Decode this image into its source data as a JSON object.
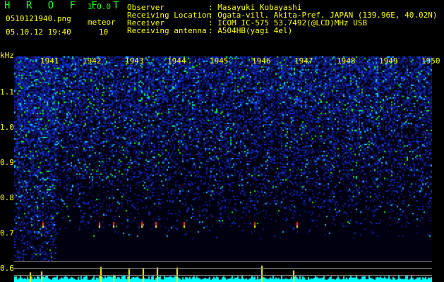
{
  "app": {
    "name": "H R O F F T",
    "version": "1.0.0"
  },
  "file": {
    "name": "0510121940.png",
    "datetime": "05.10.12 19:40"
  },
  "meteor": {
    "label": "meteor",
    "count": "10"
  },
  "info": [
    {
      "label": "Observer",
      "value": ": Masayuki Kobayashi"
    },
    {
      "label": "Receiving Location",
      "value": ": Ogata-vill. Akita-Pref. JAPAN (139.96E, 40.02N)"
    },
    {
      "label": "Receiver",
      "value": ": ICOM IC-575 53.7492(@LCD)MHz USB"
    },
    {
      "label": "Receiving antenna",
      "value": ": A504HB(yagi 4el)"
    }
  ],
  "axis": {
    "unit": "kHz",
    "y_ticks": [
      "1.1",
      "1.0",
      "0.9",
      "0.8",
      "0.7",
      "0.6"
    ],
    "time_ticks": [
      "1941",
      "1942",
      "1943",
      "1944",
      "1945",
      "1946",
      "1947",
      "1948",
      "1949",
      "1950"
    ]
  },
  "colors": {
    "text": "#ffff00",
    "title": "#22ff22",
    "histogram": "#00ffff",
    "meteor_bar": "#ffff00"
  }
}
